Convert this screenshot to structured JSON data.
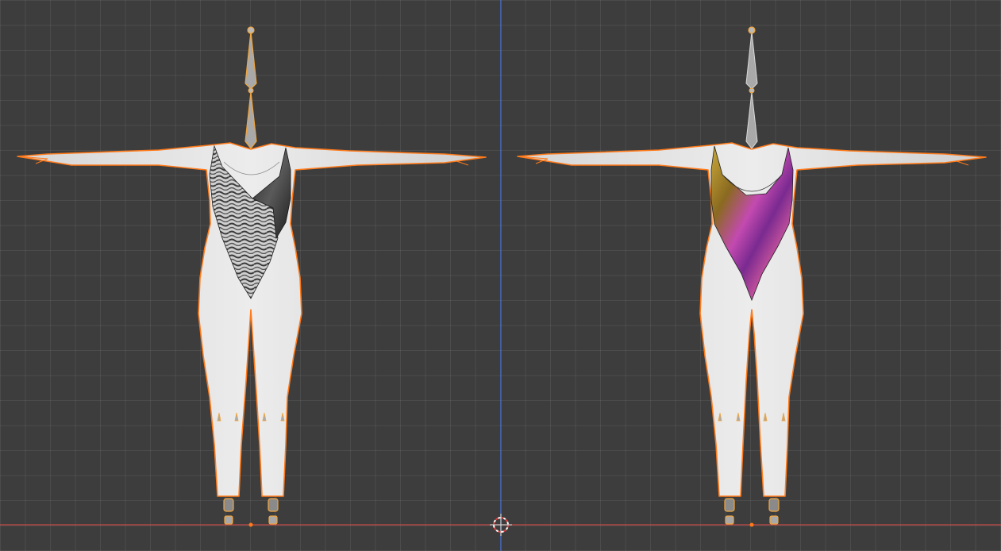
{
  "viewport": {
    "background": "#3d3d3d",
    "axis_x_color": "#c44a4a",
    "axis_z_color": "#3f6fd8",
    "selection_outline": "#ff7a1a"
  },
  "figures": [
    {
      "name": "left-figure",
      "swimsuit": "zebra-print",
      "colors": [
        "#bdbdbd",
        "#2b2b2b",
        "#666666"
      ]
    },
    {
      "name": "right-figure",
      "swimsuit": "iridescent",
      "colors": [
        "#c8a92a",
        "#8a2a8a",
        "#d94aa8",
        "#5a1a4a"
      ]
    }
  ],
  "icons": {
    "origin": "3d-cursor-icon",
    "armature": "bone-icon"
  }
}
